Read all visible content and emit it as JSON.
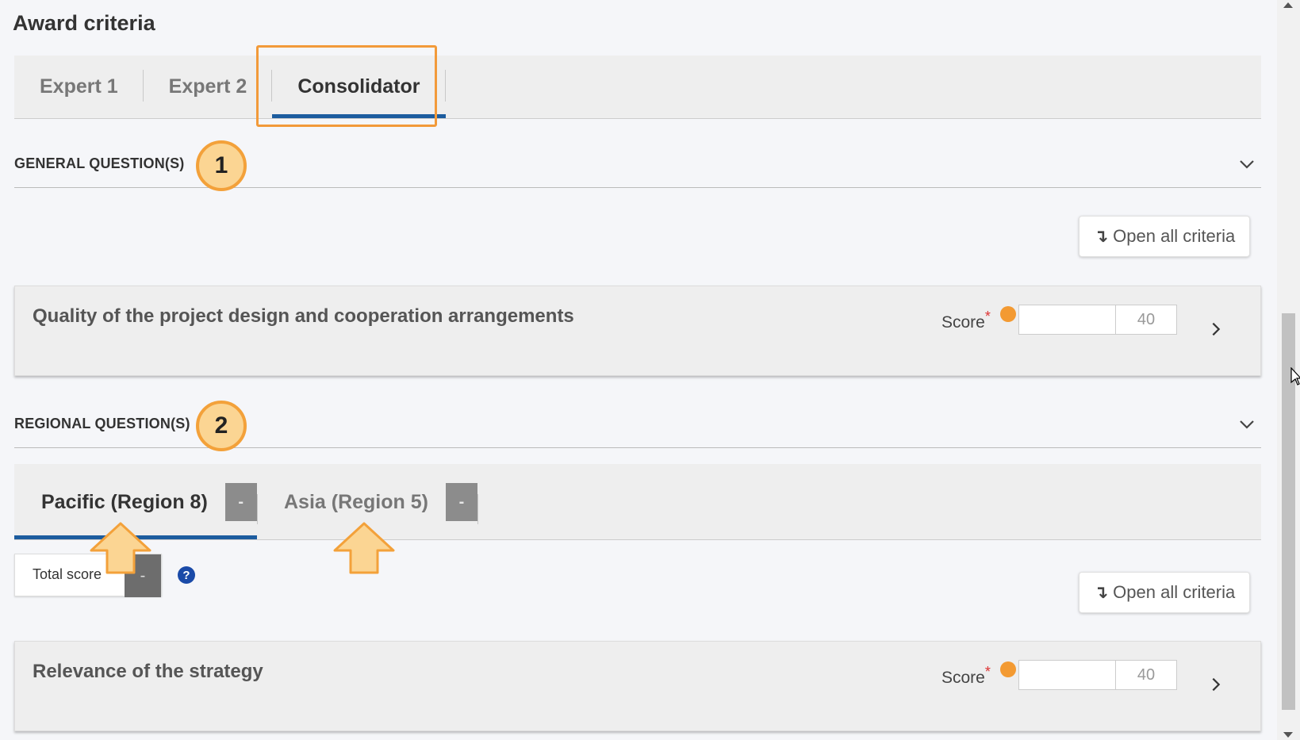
{
  "page": {
    "title": "Award criteria"
  },
  "expert_tabs": [
    {
      "label": "Expert 1",
      "active": false
    },
    {
      "label": "Expert 2",
      "active": false
    },
    {
      "label": "Consolidator",
      "active": true
    }
  ],
  "sections": {
    "general": {
      "label": "GENERAL QUESTION(S)",
      "badge": "1",
      "open_all_label": "Open all criteria",
      "card": {
        "title": "Quality of the project design and cooperation arrangements",
        "score_label": "Score",
        "required_mark": "*",
        "score_value": "",
        "score_max": "40"
      }
    },
    "regional": {
      "label": "REGIONAL QUESTION(S)",
      "badge": "2",
      "tabs": [
        {
          "label": "Pacific (Region 8)",
          "score": "-",
          "active": true
        },
        {
          "label": "Asia (Region 5)",
          "score": "-",
          "active": false
        }
      ],
      "total_score_label": "Total score",
      "total_score_value": "-",
      "help_symbol": "?",
      "open_all_label": "Open all criteria",
      "card": {
        "title": "Relevance of the strategy",
        "score_label": "Score",
        "required_mark": "*",
        "score_value": "",
        "score_max": "40"
      }
    }
  },
  "colors": {
    "accent_blue": "#1c5c9e",
    "highlight_orange": "#f29a3a",
    "badge_fill": "#fbd593",
    "required_red": "#d33333"
  },
  "icons": [
    "chevron-down-icon",
    "chevron-right-icon",
    "open-all-arrow-icon",
    "help-icon",
    "annotation-up-arrow-icon"
  ]
}
